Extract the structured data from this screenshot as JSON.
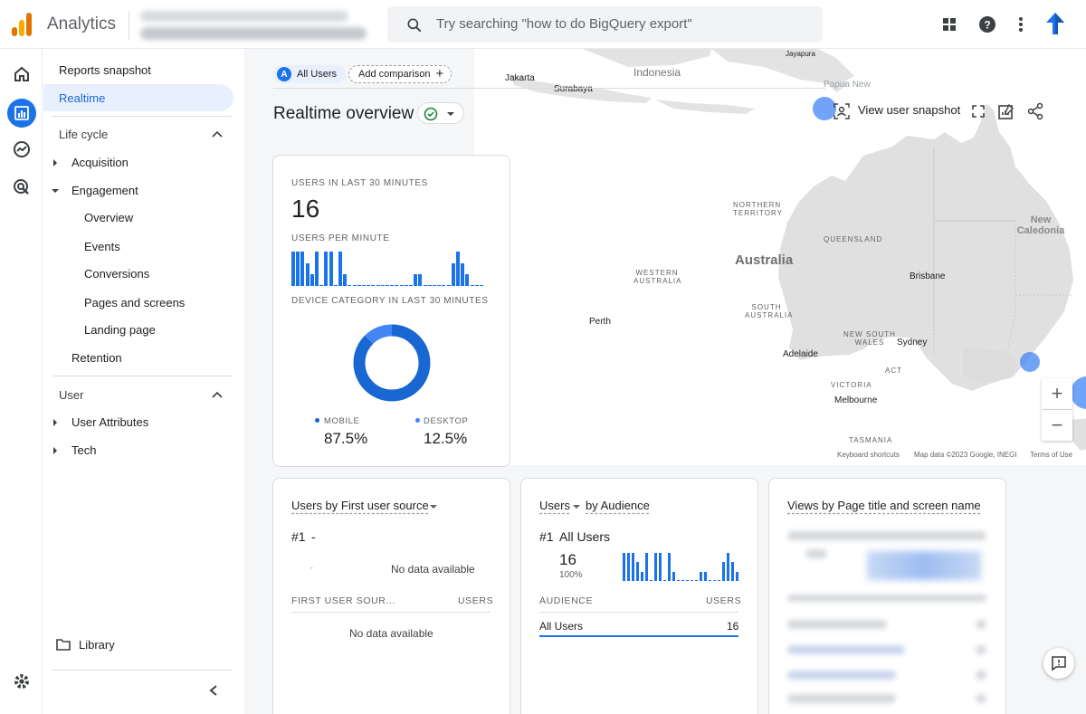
{
  "app": {
    "title": "Analytics"
  },
  "search": {
    "placeholder": "Try searching \"how to do BigQuery export\""
  },
  "header": {
    "icons": [
      "apps-icon",
      "help-icon",
      "more-vert-icon",
      "account-avatar"
    ]
  },
  "rail": {
    "icons": [
      "home-icon",
      "reports-icon",
      "explore-icon",
      "advertising-icon",
      "settings-icon"
    ]
  },
  "sidebar": {
    "reports_snapshot": "Reports snapshot",
    "realtime": "Realtime",
    "life_cycle": "Life cycle",
    "acquisition": "Acquisition",
    "engagement": "Engagement",
    "overview": "Overview",
    "events": "Events",
    "conversions": "Conversions",
    "pages_and_screens": "Pages and screens",
    "landing_page": "Landing page",
    "retention": "Retention",
    "user": "User",
    "user_attributes": "User Attributes",
    "tech": "Tech",
    "library": "Library"
  },
  "comparison": {
    "all_users": "All Users",
    "all_users_badge": "A",
    "add_comparison": "Add comparison"
  },
  "page": {
    "title": "Realtime overview",
    "view_user_snapshot": "View user snapshot"
  },
  "summary_card": {
    "users_label": "USERS IN LAST 30 MINUTES",
    "users_value": "16",
    "per_minute_label": "USERS PER MINUTE",
    "per_minute_values": [
      3,
      3,
      3,
      2,
      1,
      3,
      0,
      3,
      3,
      0,
      3,
      1,
      0,
      0,
      0,
      0,
      0,
      0,
      0,
      0,
      0,
      0,
      0,
      0,
      0,
      0,
      1,
      1,
      0,
      0,
      0,
      0,
      0,
      0,
      2,
      3,
      2,
      1,
      0,
      0,
      0
    ],
    "device_label": "DEVICE CATEGORY IN LAST 30 MINUTES",
    "mobile_label": "MOBILE",
    "mobile_value": "87.5%",
    "desktop_label": "DESKTOP",
    "desktop_value": "12.5%",
    "mobile_pct": 87.5,
    "desktop_pct": 12.5,
    "colors": {
      "mobile": "#1967d2",
      "desktop": "#4285f4"
    }
  },
  "source_card": {
    "title": "Users by First user source",
    "rank": "#1",
    "rank_value": "-",
    "dot": "-",
    "no_data": "No data available",
    "col1": "FIRST USER SOUR...",
    "col2": "USERS",
    "no_data_table": "No data available"
  },
  "audience_card": {
    "title_metric": "Users",
    "title_rest": "by Audience",
    "rank": "#1",
    "rank_value": "All Users",
    "value": "16",
    "percent": "100%",
    "spark_values": [
      3,
      3,
      3,
      2,
      1,
      3,
      0,
      3,
      3,
      0,
      3,
      1,
      0,
      0,
      0,
      0,
      0,
      1,
      1,
      0,
      0,
      0,
      2,
      3,
      2,
      1
    ],
    "col1": "AUDIENCE",
    "col2": "USERS",
    "row_label": "All Users",
    "row_value": "16"
  },
  "views_card": {
    "title": "Views by Page title and screen name"
  },
  "map": {
    "labels": {
      "indonesia": "Indonesia",
      "jakarta": "Jakarta",
      "surabaya": "Surabaya",
      "jayapura": "Jayapura",
      "papua_new": "Papua New",
      "australia": "Australia",
      "northern_territory": "NORTHERN TERRITORY",
      "queensland": "QUEENSLAND",
      "western_australia": "WESTERN AUSTRALIA",
      "south_australia": "SOUTH AUSTRALIA",
      "new_south_wales": "NEW SOUTH WALES",
      "victoria": "VICTORIA",
      "tasmania": "TASMANIA",
      "act": "ACT",
      "perth": "Perth",
      "adelaide": "Adelaide",
      "brisbane": "Brisbane",
      "sydney": "Sydney",
      "melbourne": "Melbourne",
      "new_caledonia": "New Caledonia"
    },
    "footer": {
      "shortcuts": "Keyboard shortcuts",
      "mapdata": "Map data ©2023 Google, INEGI",
      "terms": "Terms of Use"
    },
    "zoom_in": "+",
    "zoom_out": "−",
    "bubble_color": "#4285f4"
  }
}
